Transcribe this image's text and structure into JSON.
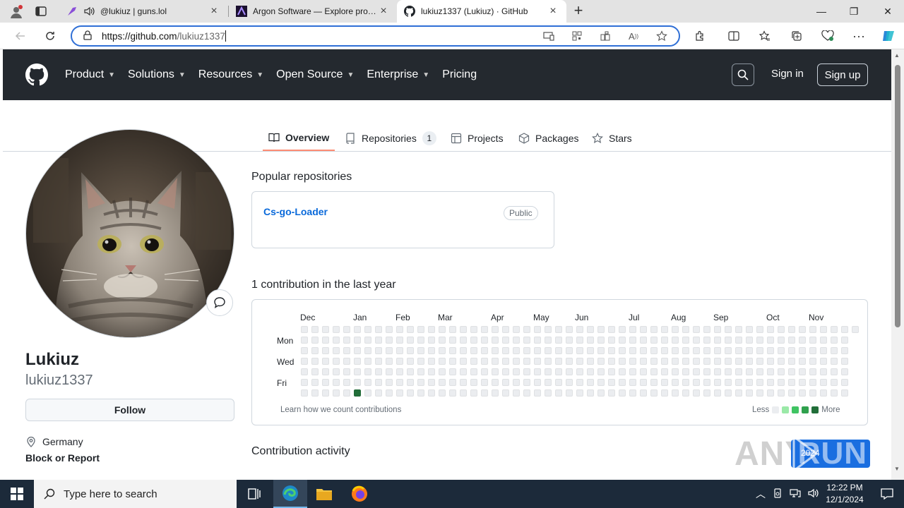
{
  "browser": {
    "tabs": [
      {
        "title": "@lukiuz | guns.lol",
        "icon": "guns-lol-favicon"
      },
      {
        "title": "Argon Software — Explore produ",
        "icon": "argon-favicon"
      },
      {
        "title": "lukiuz1337 (Lukiuz) · GitHub",
        "icon": "github-favicon"
      }
    ],
    "url_host": "https://github.com",
    "url_path": "/lukiuz1337"
  },
  "github": {
    "nav": [
      "Product",
      "Solutions",
      "Resources",
      "Open Source",
      "Enterprise",
      "Pricing"
    ],
    "sign_in": "Sign in",
    "sign_up": "Sign up"
  },
  "profile_tabs": {
    "overview": "Overview",
    "repositories": "Repositories",
    "repo_count": "1",
    "projects": "Projects",
    "packages": "Packages",
    "stars": "Stars"
  },
  "profile": {
    "name": "Lukiuz",
    "login": "lukiuz1337",
    "follow": "Follow",
    "location": "Germany",
    "block": "Block or Report"
  },
  "popular": {
    "title": "Popular repositories",
    "repo_name": "Cs-go-Loader",
    "repo_visibility": "Public"
  },
  "contributions": {
    "title": "1 contribution in the last year",
    "months": [
      "Dec",
      "Jan",
      "Feb",
      "Mar",
      "Apr",
      "May",
      "Jun",
      "Jul",
      "Aug",
      "Sep",
      "Oct",
      "Nov"
    ],
    "days": [
      "Mon",
      "Wed",
      "Fri"
    ],
    "learn": "Learn how we count contributions",
    "less": "Less",
    "more": "More",
    "colors": [
      "#ebedf0",
      "#9be9a8",
      "#40c463",
      "#30a14e",
      "#216e39"
    ]
  },
  "activity": {
    "title": "Contribution activity"
  },
  "watermark": {
    "left": "ANY",
    "right": "RUN",
    "year": "2024"
  },
  "taskbar": {
    "search_placeholder": "Type here to search",
    "time": "12:22 PM",
    "date": "12/1/2024"
  }
}
